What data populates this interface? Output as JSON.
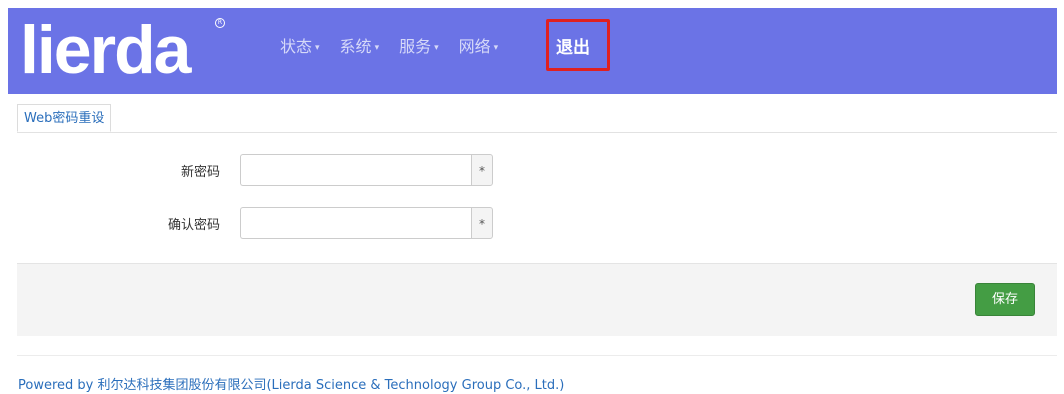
{
  "header": {
    "logo_text": "lierda",
    "nav": [
      {
        "label": "状态"
      },
      {
        "label": "系统"
      },
      {
        "label": "服务"
      },
      {
        "label": "网络"
      }
    ],
    "logout_label": "退出",
    "caret": "▾"
  },
  "tabs": [
    {
      "label": "Web密码重设"
    }
  ],
  "form": {
    "new_password_label": "新密码",
    "new_password_value": "",
    "confirm_password_label": "确认密码",
    "confirm_password_value": "",
    "required_marker": "*"
  },
  "actions": {
    "save_label": "保存"
  },
  "footer": {
    "powered_by": "Powered by 利尔达科技集团股份有限公司(Lierda Science & Technology Group Co., Ltd.)"
  },
  "colors": {
    "header_bg": "#6b73e6",
    "highlight_box": "#e02020",
    "save_button": "#449d44",
    "link": "#2a6ebb"
  }
}
